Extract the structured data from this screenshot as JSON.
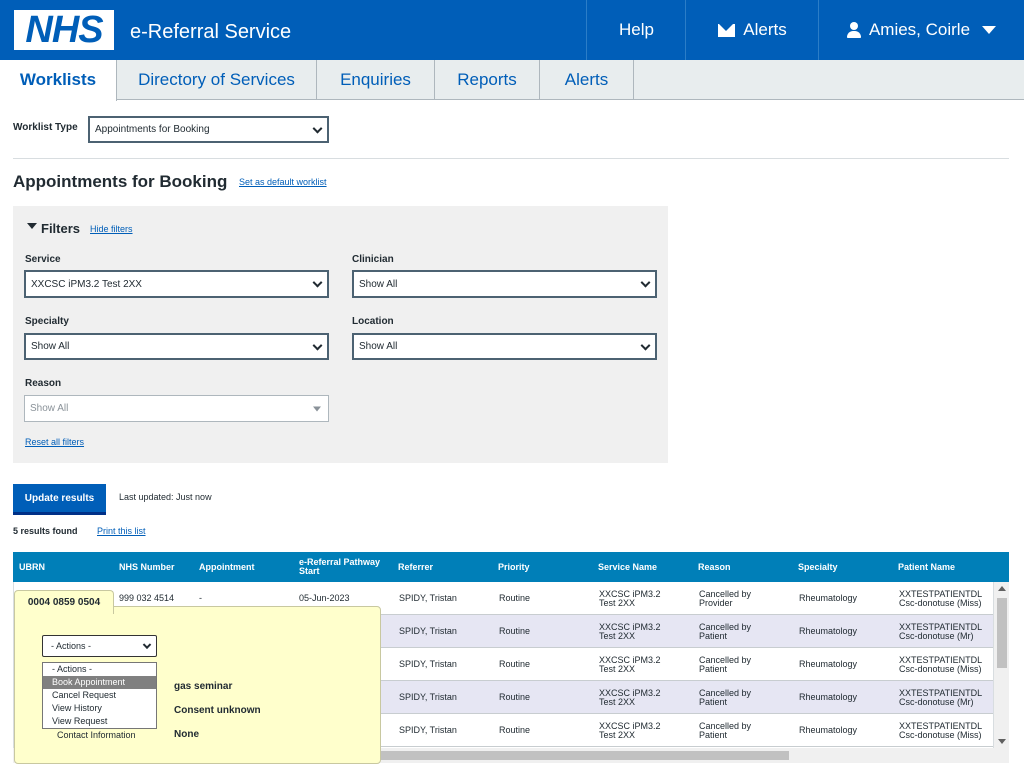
{
  "header": {
    "logo": "NHS",
    "service_name": "e-Referral Service",
    "help": "Help",
    "alerts": "Alerts",
    "user": "Amies, Coirle"
  },
  "tabs": [
    {
      "label": "Worklists"
    },
    {
      "label": "Directory of Services"
    },
    {
      "label": "Enquiries"
    },
    {
      "label": "Reports"
    },
    {
      "label": "Alerts"
    }
  ],
  "worklist_type": {
    "label": "Worklist Type",
    "value": "Appointments for Booking"
  },
  "page": {
    "title": "Appointments for Booking",
    "set_default": "Set as default worklist"
  },
  "filters": {
    "title": "Filters",
    "hide": "Hide filters",
    "service": {
      "label": "Service",
      "value": "XXCSC iPM3.2 Test 2XX"
    },
    "clinician": {
      "label": "Clinician",
      "value": "Show All"
    },
    "specialty": {
      "label": "Specialty",
      "value": "Show All"
    },
    "location": {
      "label": "Location",
      "value": "Show All"
    },
    "reason": {
      "label": "Reason",
      "value": "Show All"
    },
    "reset": "Reset all filters"
  },
  "update": {
    "button": "Update results",
    "last_updated": "Last updated: Just now"
  },
  "results": {
    "count": "5 results found",
    "print": "Print this list"
  },
  "table": {
    "headers": [
      "UBRN",
      "NHS Number",
      "Appointment",
      "e-Referral Pathway Start",
      "Referrer",
      "Priority",
      "Service Name",
      "Reason",
      "Specialty",
      "Patient Name"
    ],
    "rows": [
      {
        "ubrn": "0004 0859 0504",
        "nhs": "999 032 4514",
        "appt": "-",
        "start": "05-Jun-2023",
        "referrer": "SPIDY, Tristan",
        "priority": "Routine",
        "service": "XXCSC iPM3.2 Test 2XX",
        "reason": "Cancelled by Provider",
        "specialty": "Rheumatology",
        "patient": "XXTESTPATIENTDL Csc-donotuse (Miss)"
      },
      {
        "referrer": "SPIDY, Tristan",
        "priority": "Routine",
        "service": "XXCSC iPM3.2 Test 2XX",
        "reason": "Cancelled by Patient",
        "specialty": "Rheumatology",
        "patient": "XXTESTPATIENTDL Csc-donotuse (Mr)"
      },
      {
        "referrer": "SPIDY, Tristan",
        "priority": "Routine",
        "service": "XXCSC iPM3.2 Test 2XX",
        "reason": "Cancelled by Patient",
        "specialty": "Rheumatology",
        "patient": "XXTESTPATIENTDL Csc-donotuse (Miss)"
      },
      {
        "referrer": "SPIDY, Tristan",
        "priority": "Routine",
        "service": "XXCSC iPM3.2 Test 2XX",
        "reason": "Cancelled by Patient",
        "specialty": "Rheumatology",
        "patient": "XXTESTPATIENTDL Csc-donotuse (Mr)"
      },
      {
        "referrer": "SPIDY, Tristan",
        "priority": "Routine",
        "service": "XXCSC iPM3.2 Test 2XX",
        "reason": "Cancelled by Patient",
        "specialty": "Rheumatology",
        "patient": "XXTESTPATIENTDL Csc-donotuse (Miss)"
      }
    ]
  },
  "popup": {
    "ubrn": "0004 0859 0504",
    "actions_value": "- Actions -",
    "options": [
      "- Actions -",
      "Book Appointment",
      "Cancel Request",
      "View History",
      "View Request"
    ],
    "line1": "gas seminar",
    "line2": "Consent unknown",
    "contact_label": "Contact Information",
    "contact_value": "None"
  }
}
